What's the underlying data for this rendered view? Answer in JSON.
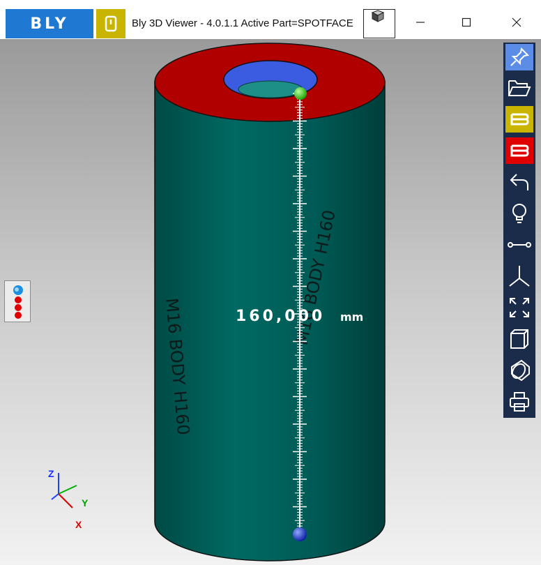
{
  "app": {
    "logo_text": "BLY",
    "window_title": "Bly 3D Viewer - 4.0.1.1 Active Part=SPOTFACE"
  },
  "measurement": {
    "value": "160,000",
    "unit": "mm"
  },
  "part_label": "M16 BODY H160",
  "axes": {
    "z": "Z",
    "y": "Y",
    "x": "X"
  },
  "toolbar": [
    "pin-icon",
    "open-folder-icon",
    "bly-yellow-icon",
    "bly-red-icon",
    "undo-icon",
    "lightbulb-icon",
    "measure-distance-icon",
    "axes-icon",
    "fit-view-icon",
    "box-view-icon",
    "section-view-icon",
    "print-icon"
  ],
  "colors": {
    "part_body": "#005c57",
    "part_top_face": "#b00000",
    "bore": "#3b5be0",
    "toolbar_bg": "#1b2c4a",
    "bly_blue": "#1f78d1",
    "accent_yellow": "#c9b500",
    "accent_red": "#e00000"
  }
}
